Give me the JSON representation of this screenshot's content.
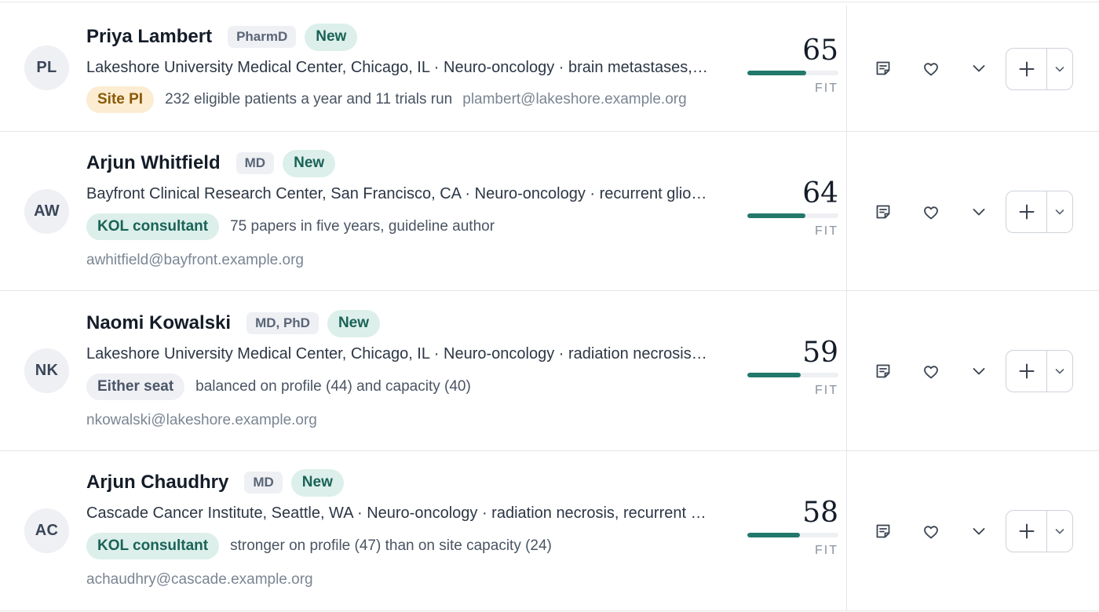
{
  "candidates": [
    {
      "initials": "PL",
      "name": "Priya Lambert",
      "credential": "PharmD",
      "status": "New",
      "details": "Lakeshore University Medical Center, Chicago, IL · Neuro-oncology · brain metastases, leptomeningeal disease",
      "role": "Site PI",
      "role_kind": "pi",
      "note": "232 eligible patients a year and 11 trials run",
      "email": "plambert@lakeshore.example.org",
      "score": "65",
      "fit_fraction": 0.65,
      "fit_label": "FIT"
    },
    {
      "initials": "AW",
      "name": "Arjun Whitfield",
      "credential": "MD",
      "status": "New",
      "details": "Bayfront Clinical Research Center, San Francisco, CA · Neuro-oncology · recurrent glioblastoma, radiation necrosis",
      "role": "KOL consultant",
      "role_kind": "kol",
      "note": "75 papers in five years, guideline author",
      "email": "awhitfield@bayfront.example.org",
      "score": "64",
      "fit_fraction": 0.64,
      "fit_label": "FIT"
    },
    {
      "initials": "NK",
      "name": "Naomi Kowalski",
      "credential": "MD, PhD",
      "status": "New",
      "details": "Lakeshore University Medical Center, Chicago, IL · Neuro-oncology · radiation necrosis, recurrent glioblastoma",
      "role": "Either seat",
      "role_kind": "either",
      "note": "balanced on profile (44) and capacity (40)",
      "email": "nkowalski@lakeshore.example.org",
      "score": "59",
      "fit_fraction": 0.59,
      "fit_label": "FIT"
    },
    {
      "initials": "AC",
      "name": "Arjun Chaudhry",
      "credential": "MD",
      "status": "New",
      "details": "Cascade Cancer Institute, Seattle, WA · Neuro-oncology · radiation necrosis, recurrent glioblastoma",
      "role": "KOL consultant",
      "role_kind": "kol",
      "note": "stronger on profile (47) than on site capacity (24)",
      "email": "achaudhry@cascade.example.org",
      "score": "58",
      "fit_fraction": 0.58,
      "fit_label": "FIT"
    }
  ],
  "icons": {
    "notes": "notes-icon",
    "favorite": "heart-icon",
    "expand": "chevron-down-icon",
    "add": "plus-icon",
    "add_menu": "chevron-down-icon"
  },
  "colors": {
    "fit_bar": "#23786c",
    "new_badge_bg": "#dcefeb",
    "site_pi_bg": "#fbecd2"
  }
}
